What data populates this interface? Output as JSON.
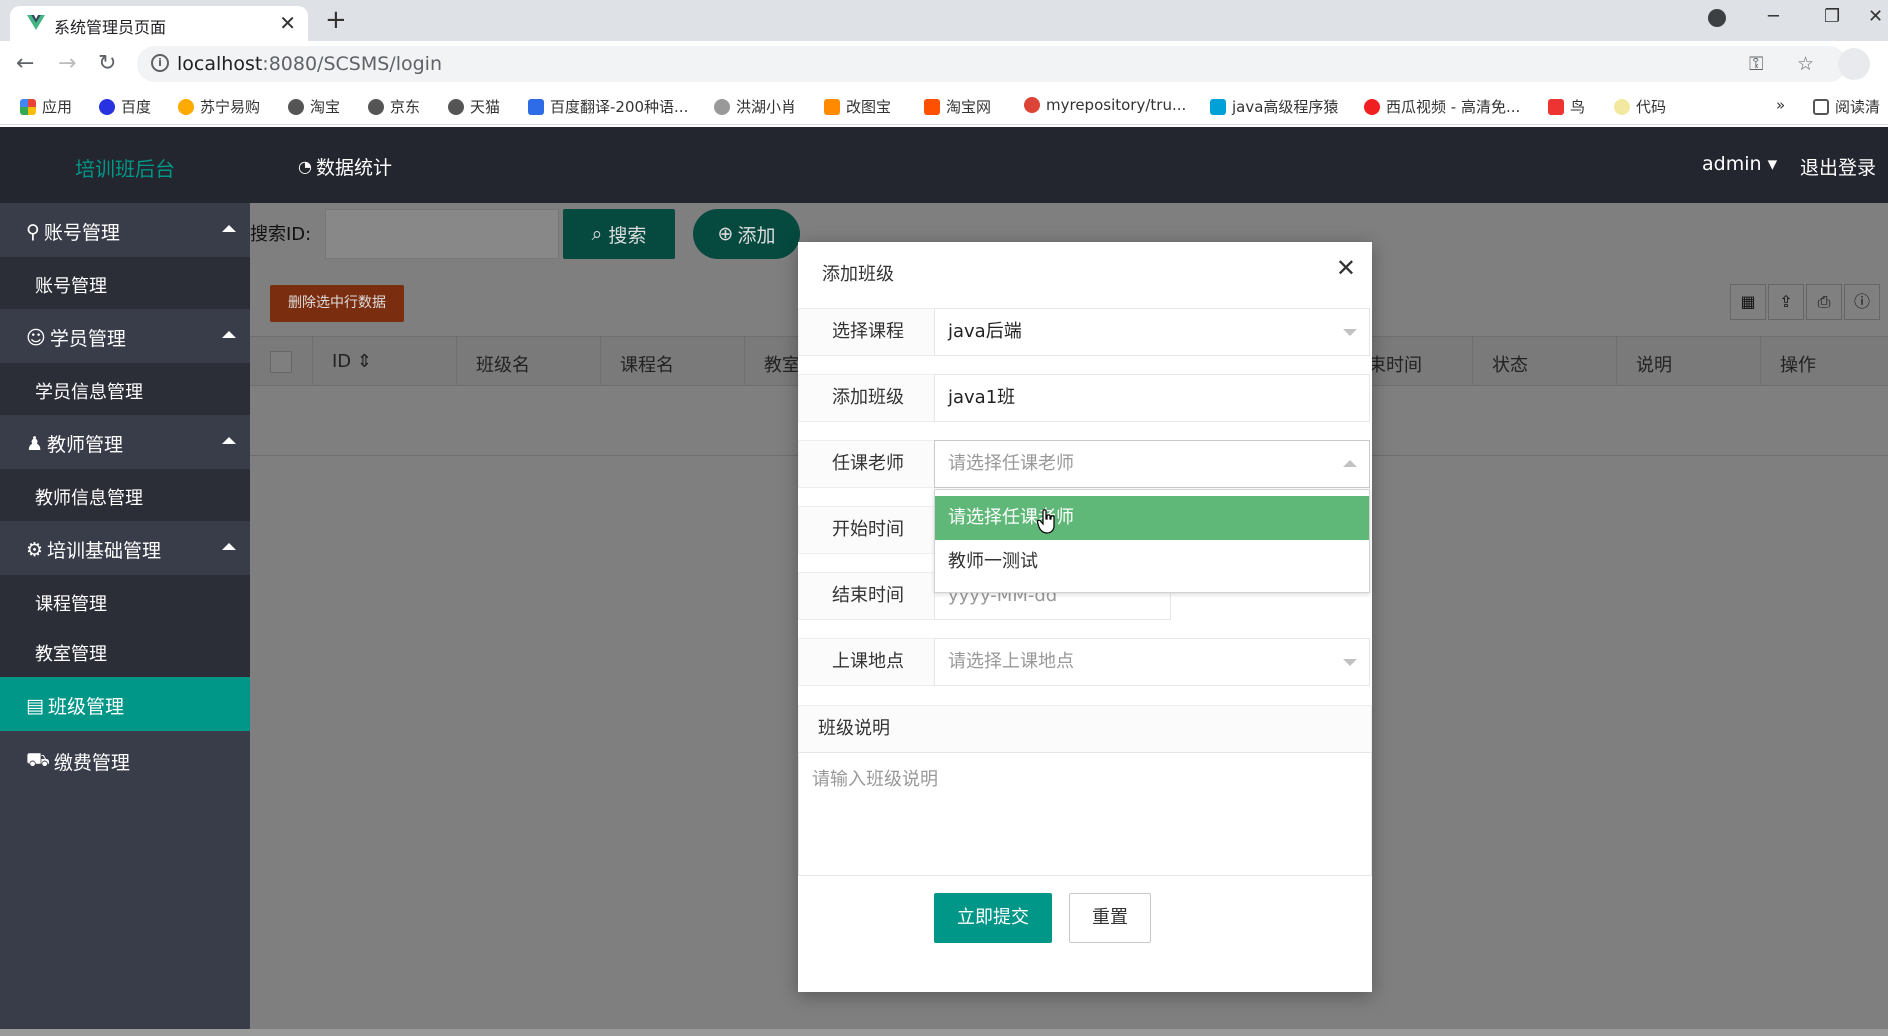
{
  "browser": {
    "tab_title": "系统管理员页面",
    "url_host": "localhost",
    "url_rest": ":8080/SCSMS/login",
    "bookmarks": [
      "应用",
      "百度",
      "苏宁易购",
      "淘宝",
      "京东",
      "天猫",
      "百度翻译-200种语...",
      "洪湖小肖",
      "改图宝",
      "淘宝网",
      "myrepository/tru...",
      "java高级程序猿",
      "西瓜视频 - 高清免...",
      "鸟",
      "代码",
      "阅读清"
    ],
    "more_bookmarks": "»"
  },
  "header": {
    "brand": "培训班后台",
    "nav_stat": "数据统计",
    "user": "admin",
    "logout": "退出登录"
  },
  "sidebar": {
    "groups": [
      {
        "label": "账号管理",
        "items": [
          "账号管理"
        ]
      },
      {
        "label": "学员管理",
        "items": [
          "学员信息管理"
        ]
      },
      {
        "label": "教师管理",
        "items": [
          "教师信息管理"
        ]
      },
      {
        "label": "培训基础管理",
        "items": [
          "课程管理",
          "教室管理"
        ]
      }
    ],
    "active": "班级管理",
    "last": "缴费管理"
  },
  "toolbar": {
    "search_label": "搜索ID:",
    "search_button": "搜索",
    "add_button": "添加",
    "delete_button": "删除选中行数据"
  },
  "table": {
    "columns": [
      "ID",
      "班级名",
      "课程名",
      "教室",
      "束时间",
      "状态",
      "说明",
      "操作"
    ]
  },
  "modal": {
    "title": "添加班级",
    "fields": [
      {
        "label": "选择课程",
        "value": "java后端"
      },
      {
        "label": "添加班级",
        "value": "java1班"
      },
      {
        "label": "任课老师",
        "placeholder": "请选择任课老师"
      },
      {
        "label": "开始时间",
        "placeholder": ""
      },
      {
        "label": "结束时间",
        "placeholder": "yyyy-MM-dd"
      },
      {
        "label": "上课地点",
        "placeholder": "请选择上课地点"
      }
    ],
    "dropdown_options": [
      "请选择任课老师",
      "教师一测试"
    ],
    "desc_label": "班级说明",
    "desc_placeholder": "请输入班级说明",
    "submit": "立即提交",
    "reset": "重置"
  }
}
